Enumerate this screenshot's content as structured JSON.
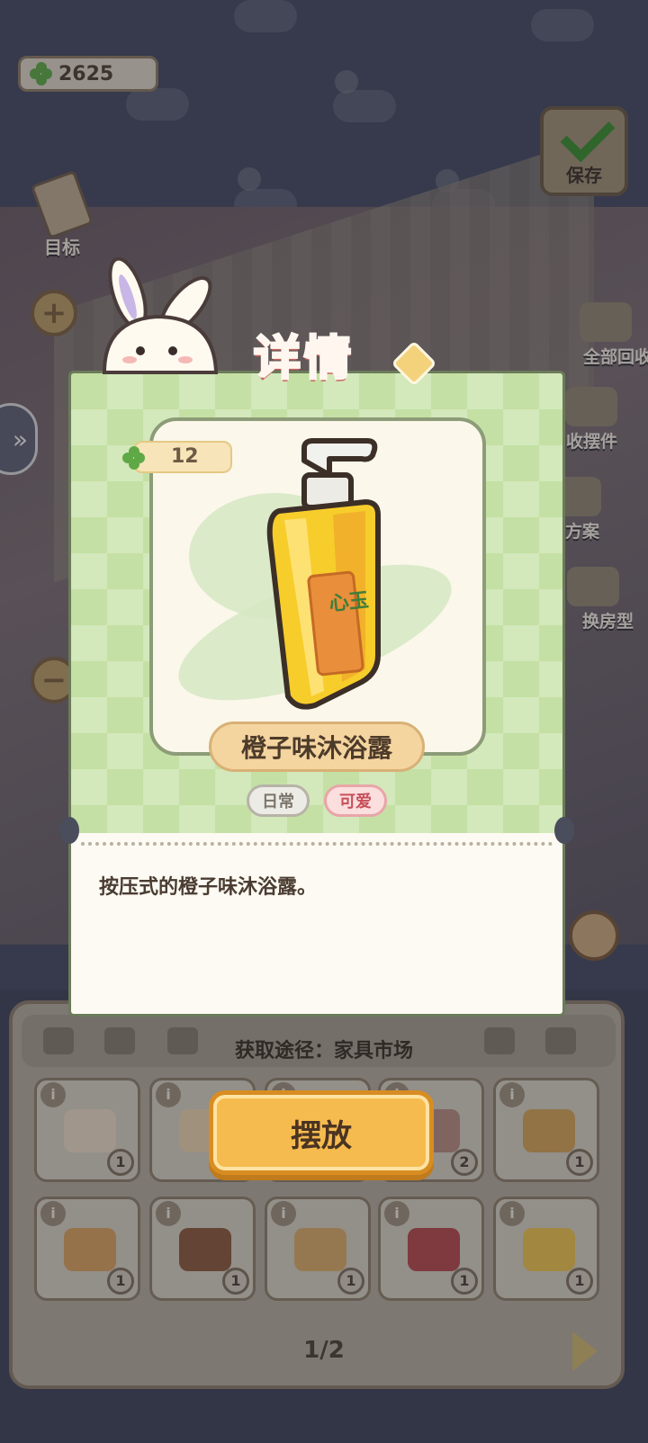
{
  "hud": {
    "clover_count": "2625",
    "save_label": "保存",
    "goal_label": "目标"
  },
  "right_menu": {
    "items": [
      {
        "label": "全部回收"
      },
      {
        "label": "收摆件"
      },
      {
        "label": "方案"
      },
      {
        "label": "换房型"
      }
    ]
  },
  "detail": {
    "title": "详情",
    "price": "12",
    "item_name": "橙子味沐浴露",
    "tags": [
      "日常",
      "可爱"
    ],
    "description": "按压式的橙子味沐浴露。",
    "source": "获取途径：家具市场",
    "place_button": "摆放",
    "bottle_label_glyphs": "心玉"
  },
  "inventory": {
    "slots": [
      {
        "icon": "cake-slice-icon",
        "count": "1",
        "color": "#e9d7c0"
      },
      {
        "icon": "cupcake-icon",
        "count": "",
        "color": "#e6cfaa"
      },
      {
        "icon": "unknown-item-icon",
        "count": "",
        "color": "#d6cab6"
      },
      {
        "icon": "book-icon",
        "count": "2",
        "color": "#b48b7e"
      },
      {
        "icon": "bread-tray-icon",
        "count": "1",
        "color": "#cfa256"
      },
      {
        "icon": "donut-icon",
        "count": "1",
        "color": "#d7a05f"
      },
      {
        "icon": "layer-cake-icon",
        "count": "1",
        "color": "#8b5a3c"
      },
      {
        "icon": "bread-loaf-icon",
        "count": "1",
        "color": "#d7aa66"
      },
      {
        "icon": "red-jar-icon",
        "count": "1",
        "color": "#b34a4a"
      },
      {
        "icon": "soap-bottle-icon",
        "count": "1",
        "color": "#e9c14d"
      }
    ],
    "page": "1/2"
  }
}
